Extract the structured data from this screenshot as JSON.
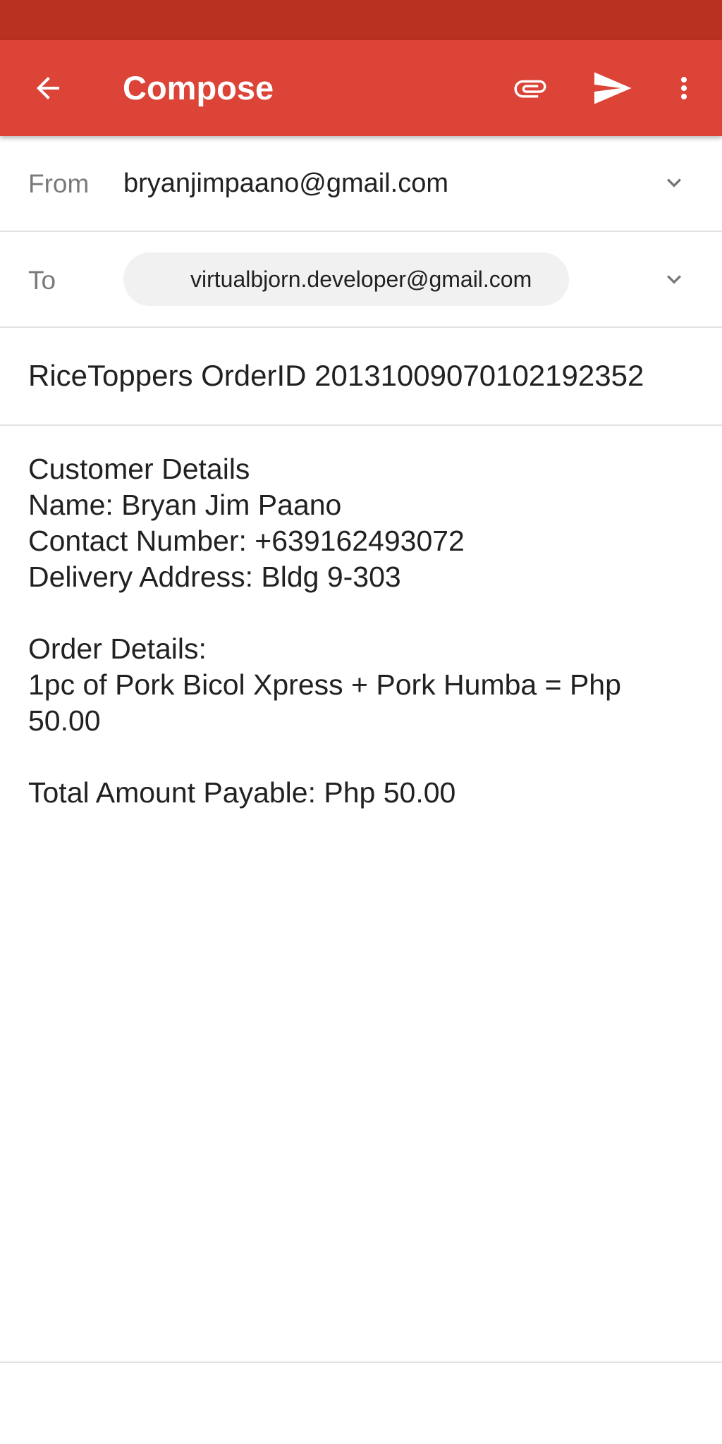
{
  "colors": {
    "status_bar": "#b93221",
    "app_bar": "#db4437",
    "chip_background": "#f1f1f1"
  },
  "app_bar": {
    "title": "Compose",
    "icons": [
      "arrow-back-icon",
      "paperclip-icon",
      "send-icon",
      "more-vert-icon"
    ]
  },
  "from": {
    "label": "From",
    "value": "bryanjimpaano@gmail.com"
  },
  "to": {
    "label": "To",
    "recipient": "virtualbjorn.developer@gmail.com"
  },
  "subject": "RiceToppers OrderID 20131009070102192352",
  "body": {
    "customer_heading": "Customer Details",
    "name": "Name: Bryan Jim Paano",
    "contact": "Contact Number: +639162493072",
    "address": "Delivery Address: Bldg 9-303",
    "order_heading": "Order Details:",
    "order_line_1": "1pc of Pork Bicol Xpress + Pork Humba = Php",
    "order_line_2": "50.00",
    "total": "Total Amount Payable: Php 50.00"
  }
}
